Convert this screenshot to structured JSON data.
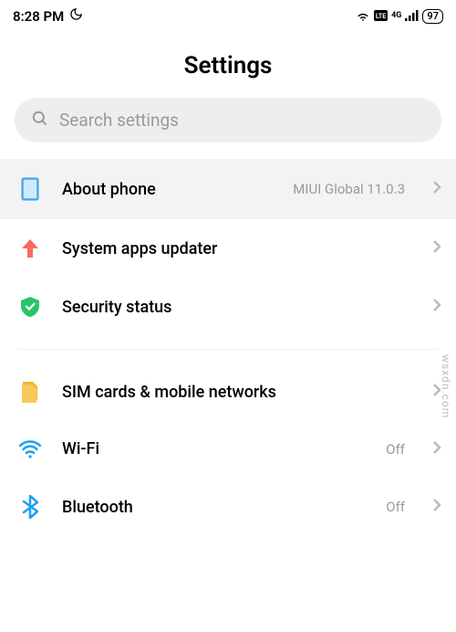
{
  "status_bar": {
    "time": "8:28 PM",
    "network_label": "4G",
    "battery": "97"
  },
  "page_title": "Settings",
  "search": {
    "placeholder": "Search settings"
  },
  "items": {
    "about_phone": {
      "label": "About phone",
      "value": "MIUI Global 11.0.3"
    },
    "system_updater": {
      "label": "System apps updater",
      "value": ""
    },
    "security_status": {
      "label": "Security status",
      "value": ""
    },
    "sim_networks": {
      "label": "SIM cards & mobile networks",
      "value": ""
    },
    "wifi": {
      "label": "Wi-Fi",
      "value": "Off"
    },
    "bluetooth": {
      "label": "Bluetooth",
      "value": "Off"
    }
  },
  "watermark": "wsxdn.com"
}
